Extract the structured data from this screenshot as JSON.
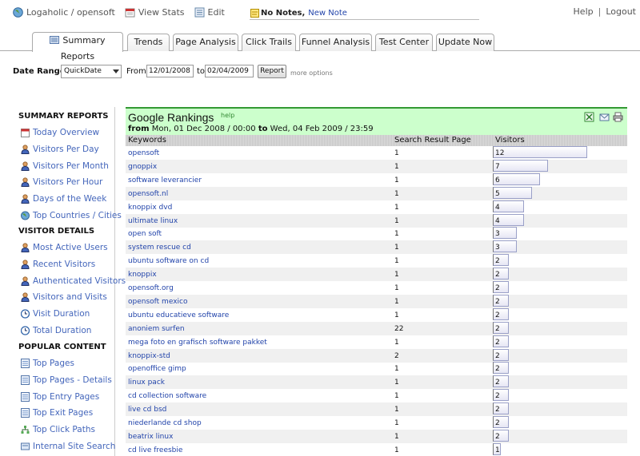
{
  "topbar": {
    "site": "Logaholic / opensoft",
    "view_stats": "View Stats",
    "edit": "Edit",
    "notes_count": "No Notes,",
    "new_note": "New Note",
    "help": "Help",
    "logout": "Logout"
  },
  "tabs": [
    "Summary Reports",
    "Trends",
    "Page Analysis",
    "Click Trails",
    "Funnel Analysis",
    "Test Center",
    "Update Now"
  ],
  "datebar": {
    "label": "Date Range:",
    "select": "QuickDate",
    "from_label": "From",
    "from": "12/01/2008",
    "to_label": "to",
    "to": "02/04/2009",
    "button": "Report",
    "more": "more options"
  },
  "sidebar": {
    "sections": [
      {
        "title": "SUMMARY REPORTS",
        "items": [
          {
            "label": "Today Overview",
            "icon": "calendar-icon"
          },
          {
            "label": "Visitors Per Day",
            "icon": "user-icon"
          },
          {
            "label": "Visitors Per Month",
            "icon": "user-icon"
          },
          {
            "label": "Visitors Per Hour",
            "icon": "user-icon"
          },
          {
            "label": "Days of the Week",
            "icon": "user-icon"
          },
          {
            "label": "Top Countries / Cities",
            "icon": "globe-icon"
          }
        ]
      },
      {
        "title": "VISITOR DETAILS",
        "items": [
          {
            "label": "Most Active Users",
            "icon": "user-icon"
          },
          {
            "label": "Recent Visitors",
            "icon": "user-icon"
          },
          {
            "label": "Authenticated Visitors",
            "icon": "user-icon"
          },
          {
            "label": "Visitors and Visits",
            "icon": "user-icon"
          },
          {
            "label": "Visit Duration",
            "icon": "clock-icon"
          },
          {
            "label": "Total Duration",
            "icon": "clock-icon"
          }
        ]
      },
      {
        "title": "POPULAR CONTENT",
        "items": [
          {
            "label": "Top Pages",
            "icon": "page-icon"
          },
          {
            "label": "Top Pages - Details",
            "icon": "page-icon"
          },
          {
            "label": "Top Entry Pages",
            "icon": "page-icon"
          },
          {
            "label": "Top Exit Pages",
            "icon": "page-icon"
          },
          {
            "label": "Top Click Paths",
            "icon": "sitemap-icon"
          },
          {
            "label": "Internal Site Search",
            "icon": "search-icon"
          }
        ]
      }
    ]
  },
  "report": {
    "title": "Google Rankings",
    "help": "help",
    "range_from_label": "from",
    "range_from": "Mon, 01 Dec 2008 / 00:00",
    "range_to_label": "to",
    "range_to": "Wed, 04 Feb 2009 / 23:59",
    "columns": [
      "Keywords",
      "Search Result Page",
      "Visitors"
    ],
    "max_visitors": 12,
    "rows": [
      {
        "keyword": "opensoft",
        "page": "1",
        "visitors": 12
      },
      {
        "keyword": "gnoppix",
        "page": "1",
        "visitors": 7
      },
      {
        "keyword": "software leverancier",
        "page": "1",
        "visitors": 6
      },
      {
        "keyword": "opensoft.nl",
        "page": "1",
        "visitors": 5
      },
      {
        "keyword": "knoppix dvd",
        "page": "1",
        "visitors": 4
      },
      {
        "keyword": "ultimate linux",
        "page": "1",
        "visitors": 4
      },
      {
        "keyword": "open soft",
        "page": "1",
        "visitors": 3
      },
      {
        "keyword": "system rescue cd",
        "page": "1",
        "visitors": 3
      },
      {
        "keyword": "ubuntu software on cd",
        "page": "1",
        "visitors": 2
      },
      {
        "keyword": "knoppix",
        "page": "1",
        "visitors": 2
      },
      {
        "keyword": "opensoft.org",
        "page": "1",
        "visitors": 2
      },
      {
        "keyword": "opensoft mexico",
        "page": "1",
        "visitors": 2
      },
      {
        "keyword": "ubuntu educatieve software",
        "page": "1",
        "visitors": 2
      },
      {
        "keyword": "anoniem surfen",
        "page": "22",
        "visitors": 2
      },
      {
        "keyword": "mega foto en grafisch software pakket",
        "page": "1",
        "visitors": 2
      },
      {
        "keyword": "knoppix-std",
        "page": "2",
        "visitors": 2
      },
      {
        "keyword": "openoffice gimp",
        "page": "1",
        "visitors": 2
      },
      {
        "keyword": "linux pack",
        "page": "1",
        "visitors": 2
      },
      {
        "keyword": "cd collection software",
        "page": "1",
        "visitors": 2
      },
      {
        "keyword": "live cd bsd",
        "page": "1",
        "visitors": 2
      },
      {
        "keyword": "niederlande cd shop",
        "page": "1",
        "visitors": 2
      },
      {
        "keyword": "beatrix linux",
        "page": "1",
        "visitors": 2
      },
      {
        "keyword": "cd live freesbie",
        "page": "1",
        "visitors": 1
      }
    ]
  }
}
